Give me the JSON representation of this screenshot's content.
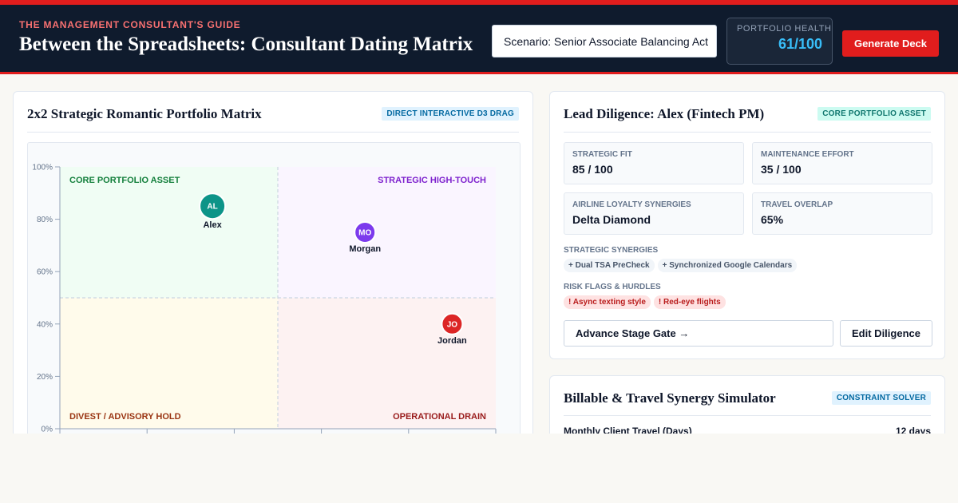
{
  "header": {
    "eyebrow": "THE MANAGEMENT CONSULTANT'S GUIDE",
    "title": "Between the Spreadsheets: Consultant Dating Matrix",
    "scenario_selected": "Scenario: Senior Associate Balancing Act",
    "health_label": "PORTFOLIO HEALTH",
    "health_value": "61/100",
    "generate_label": "Generate Deck"
  },
  "matrix": {
    "title": "2x2 Strategic Romantic Portfolio Matrix",
    "badge": "DIRECT INTERACTIVE D3 DRAG",
    "quadrants": {
      "top_left": "CORE PORTFOLIO ASSET",
      "top_right": "STRATEGIC HIGH-TOUCH",
      "bottom_left": "DIVEST / ADVISORY HOLD",
      "bottom_right": "OPERATIONAL DRAIN"
    }
  },
  "chart_data": {
    "type": "scatter",
    "y_ticks": [
      "0%",
      "20%",
      "40%",
      "60%",
      "80%",
      "100%"
    ],
    "ylim": [
      0,
      100
    ],
    "xlim": [
      0,
      100
    ],
    "points": [
      {
        "initials": "AL",
        "name": "Alex",
        "x": 35,
        "y": 85,
        "color": "#0d9488"
      },
      {
        "initials": "MO",
        "name": "Morgan",
        "x": 70,
        "y": 75,
        "color": "#7c3aed"
      },
      {
        "initials": "JO",
        "name": "Jordan",
        "x": 90,
        "y": 40,
        "color": "#dc2626"
      }
    ]
  },
  "lead": {
    "title": "Lead Diligence: Alex (Fintech PM)",
    "badge": "CORE PORTFOLIO ASSET",
    "stats": [
      {
        "label": "STRATEGIC FIT",
        "value": "85 / 100"
      },
      {
        "label": "MAINTENANCE EFFORT",
        "value": "35 / 100"
      },
      {
        "label": "AIRLINE LOYALTY SYNERGIES",
        "value": "Delta Diamond"
      },
      {
        "label": "TRAVEL OVERLAP",
        "value": "65%"
      }
    ],
    "synergies_label": "STRATEGIC SYNERGIES",
    "synergies": [
      "+ Dual TSA PreCheck",
      "+ Synchronized Google Calendars"
    ],
    "risks_label": "RISK FLAGS & HURDLES",
    "risks": [
      "! Async texting style",
      "! Red-eye flights"
    ],
    "advance_label": "Advance Stage Gate →",
    "edit_label": "Edit Diligence"
  },
  "simulator": {
    "title": "Billable & Travel Synergy Simulator",
    "badge": "CONSTRAINT SOLVER",
    "row_label": "Monthly Client Travel (Days)",
    "row_value": "12 days"
  },
  "colors": {
    "navy": "#0f1b2d",
    "accent_red": "#e11d1d",
    "health_blue": "#38bdf8",
    "teal": "#0d9488",
    "purple": "#7c3aed"
  }
}
